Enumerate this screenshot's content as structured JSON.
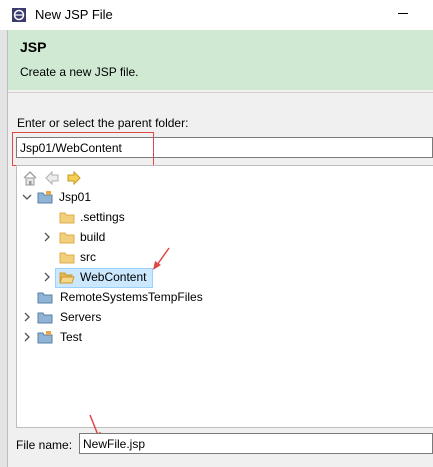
{
  "window": {
    "title": "New JSP File"
  },
  "banner": {
    "title": "JSP",
    "description": "Create a new JSP file."
  },
  "parent_folder": {
    "label": "Enter or select the parent folder:",
    "value": "Jsp01/WebContent"
  },
  "toolbar_icons": [
    "home-icon",
    "back-arrow-icon",
    "forward-arrow-icon"
  ],
  "tree": {
    "jsp01": "Jsp01",
    "settings": ".settings",
    "build": "build",
    "src": "src",
    "webcontent": "WebContent",
    "remote": "RemoteSystemsTempFiles",
    "servers": "Servers",
    "test": "Test",
    "selected": "WebContent"
  },
  "file_name": {
    "label": "File name:",
    "value": "NewFile.jsp"
  },
  "colors": {
    "banner": "#cfe9d3",
    "annotation": "#e04848",
    "selection": "#cce8ff",
    "folder": "#dcae4b"
  }
}
